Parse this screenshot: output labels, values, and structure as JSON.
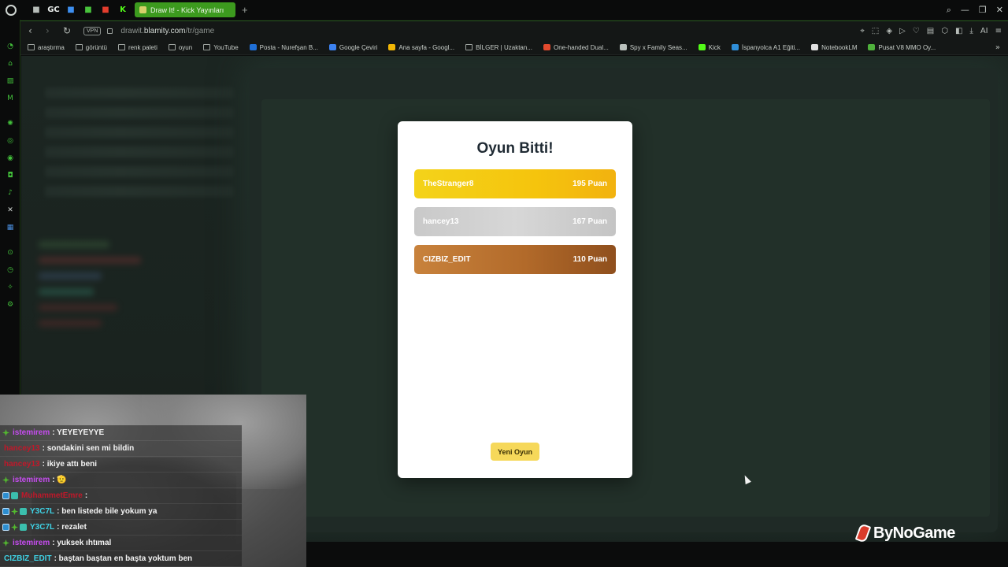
{
  "browser": {
    "pinned_tabs": [
      {
        "icon": "gamepad-icon",
        "label": "",
        "color": "#b7bdb9"
      },
      {
        "icon": "gc-icon",
        "label": "GC",
        "color": "#e8ecea"
      },
      {
        "icon": "play-store-icon",
        "label": "",
        "color": "#3d8ff0"
      },
      {
        "icon": "bars-icon",
        "label": "",
        "color": "#48c33c"
      },
      {
        "icon": "youtube-icon",
        "label": "",
        "color": "#e33d2d"
      },
      {
        "icon": "kick-icon",
        "label": "K",
        "color": "#53fc18"
      }
    ],
    "active_tab": {
      "label": "Draw It! - Kick Yayınları"
    },
    "url_prefix": "drawit.",
    "url_domain": "blamity.com",
    "url_path": "/tr/game",
    "vpn_label": "VPN",
    "bookmarks": [
      {
        "label": "araştırma",
        "icon": "folder-icon"
      },
      {
        "label": "görüntü",
        "icon": "folder-icon"
      },
      {
        "label": "renk paleti",
        "icon": "folder-icon"
      },
      {
        "label": "oyun",
        "icon": "folder-icon"
      },
      {
        "label": "YouTube",
        "icon": "page-icon"
      },
      {
        "label": "Posta - Nurefşan B...",
        "icon": "outlook-icon"
      },
      {
        "label": "Google Çeviri",
        "icon": "translate-icon"
      },
      {
        "label": "Ana sayfa - Googl...",
        "icon": "drive-icon"
      },
      {
        "label": "BİLGER | Uzaktan...",
        "icon": "page-icon"
      },
      {
        "label": "One-handed Dual...",
        "icon": "video-icon"
      },
      {
        "label": "Spy x Family Seas...",
        "icon": "shield-icon"
      },
      {
        "label": "Kick",
        "icon": "kick-icon"
      },
      {
        "label": "İspanyolca A1 Eğiti...",
        "icon": "globe-icon"
      },
      {
        "label": "NotebookLM",
        "icon": "notebook-icon"
      },
      {
        "label": "Pusat V8 MMO Oy...",
        "icon": "game-icon"
      }
    ]
  },
  "modal": {
    "title": "Oyun Bitti!",
    "results": [
      {
        "name": "TheStranger8",
        "score": "195 Puan"
      },
      {
        "name": "hancey13",
        "score": "167 Puan"
      },
      {
        "name": "CIZBIZ_EDIT",
        "score": "110 Puan"
      }
    ],
    "new_game_label": "Yeni Oyun"
  },
  "chat": [
    {
      "badges": [
        "sub"
      ],
      "user": "istemirem",
      "user_color": "#c64cf0",
      "message": ": YEYEYEYYE"
    },
    {
      "badges": [],
      "user": "hancey13",
      "user_color": "#c0182a",
      "message": ": sondakini sen mi bildin"
    },
    {
      "badges": [],
      "user": "hancey13",
      "user_color": "#c0182a",
      "message": ": ikiye attı beni"
    },
    {
      "badges": [
        "sub"
      ],
      "user": "istemirem",
      "user_color": "#c64cf0",
      "message": ": 🫡"
    },
    {
      "badges": [
        "mod",
        "gift"
      ],
      "user": "MuhammetEmre",
      "user_color": "#c0182a",
      "message": ":"
    },
    {
      "badges": [
        "mod",
        "sub",
        "gift"
      ],
      "user": "Y3C7L",
      "user_color": "#3fd3e6",
      "message": ": ben listede bile yokum ya"
    },
    {
      "badges": [
        "mod",
        "sub",
        "gift"
      ],
      "user": "Y3C7L",
      "user_color": "#3fd3e6",
      "message": ": rezalet"
    },
    {
      "badges": [
        "sub"
      ],
      "user": "istemirem",
      "user_color": "#c64cf0",
      "message": ": yuksek ıhtımal"
    },
    {
      "badges": [],
      "user": "CIZBIZ_EDIT",
      "user_color": "#3fd3e6",
      "message": ": baştan baştan en başta yoktum ben"
    }
  ],
  "brand": {
    "name": "ByNoGame"
  }
}
